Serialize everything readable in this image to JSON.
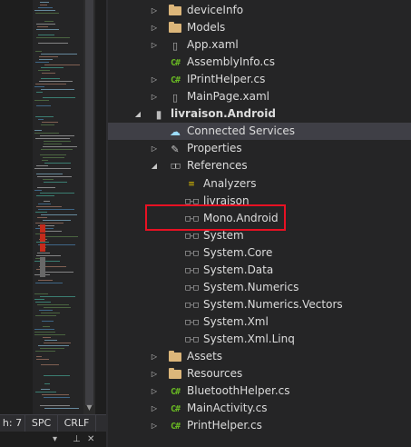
{
  "editor": {
    "status": {
      "column": "h: 7",
      "spacing": "SPC",
      "line_ending": "CRLF"
    }
  },
  "solution_explorer": {
    "items": [
      {
        "label": "deviceInfo",
        "icon": "folder-icon",
        "kind": "folder",
        "expander": "collapsed"
      },
      {
        "label": "Models",
        "icon": "folder-icon",
        "kind": "folder",
        "expander": "collapsed"
      },
      {
        "label": "App.xaml",
        "icon": "xaml-file-icon",
        "kind": "xaml",
        "expander": "collapsed"
      },
      {
        "label": "AssemblyInfo.cs",
        "icon": "csharp-file-icon",
        "kind": "cs",
        "expander": "none"
      },
      {
        "label": "IPrintHelper.cs",
        "icon": "csharp-file-icon",
        "kind": "cs",
        "expander": "collapsed"
      },
      {
        "label": "MainPage.xaml",
        "icon": "xaml-file-icon",
        "kind": "xaml",
        "expander": "collapsed"
      },
      {
        "label": "livraison.Android",
        "icon": "android-project-icon",
        "kind": "project",
        "expander": "expanded"
      },
      {
        "label": "Connected Services",
        "icon": "cloud-icon",
        "kind": "service",
        "expander": "none"
      },
      {
        "label": "Properties",
        "icon": "wrench-icon",
        "kind": "properties",
        "expander": "collapsed"
      },
      {
        "label": "References",
        "icon": "references-icon",
        "kind": "references",
        "expander": "expanded"
      },
      {
        "label": "Analyzers",
        "icon": "analyzers-icon",
        "kind": "analyzers",
        "expander": "none"
      },
      {
        "label": "livraison",
        "icon": "reference-icon",
        "kind": "ref",
        "expander": "none"
      },
      {
        "label": "Mono.Android",
        "icon": "reference-icon",
        "kind": "ref",
        "expander": "none"
      },
      {
        "label": "System",
        "icon": "reference-icon",
        "kind": "ref",
        "expander": "none"
      },
      {
        "label": "System.Core",
        "icon": "reference-icon",
        "kind": "ref",
        "expander": "none"
      },
      {
        "label": "System.Data",
        "icon": "reference-icon",
        "kind": "ref",
        "expander": "none"
      },
      {
        "label": "System.Numerics",
        "icon": "reference-icon",
        "kind": "ref",
        "expander": "none"
      },
      {
        "label": "System.Numerics.Vectors",
        "icon": "reference-icon",
        "kind": "ref",
        "expander": "none"
      },
      {
        "label": "System.Xml",
        "icon": "reference-icon",
        "kind": "ref",
        "expander": "none"
      },
      {
        "label": "System.Xml.Linq",
        "icon": "reference-icon",
        "kind": "ref",
        "expander": "none"
      },
      {
        "label": "Assets",
        "icon": "folder-icon",
        "kind": "folder",
        "expander": "collapsed"
      },
      {
        "label": "Resources",
        "icon": "folder-icon",
        "kind": "folder",
        "expander": "collapsed"
      },
      {
        "label": "BluetoothHelper.cs",
        "icon": "csharp-file-icon",
        "kind": "cs",
        "expander": "collapsed"
      },
      {
        "label": "MainActivity.cs",
        "icon": "csharp-file-icon",
        "kind": "cs",
        "expander": "collapsed"
      },
      {
        "label": "PrintHelper.cs",
        "icon": "csharp-file-icon",
        "kind": "cs",
        "expander": "collapsed"
      }
    ],
    "highlighted_item": "Mono.Android"
  },
  "colors": {
    "background": "#252526",
    "selection": "#3f3f46",
    "highlight_box": "#e81123",
    "folder": "#dcb67a",
    "csharp": "#68b723"
  }
}
